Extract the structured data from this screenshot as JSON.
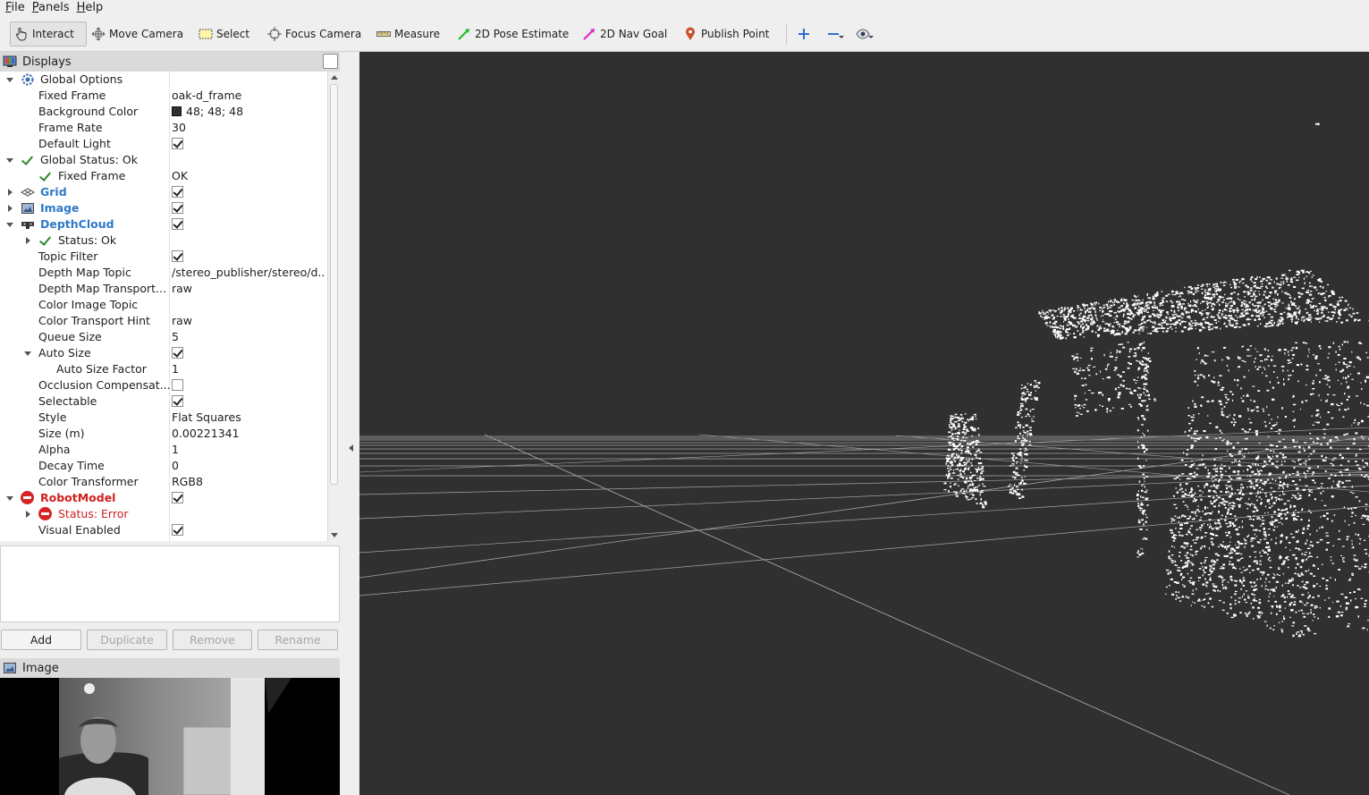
{
  "menu": [
    {
      "label": "File",
      "mnemonic": "F",
      "rest": "ile"
    },
    {
      "label": "Panels",
      "mnemonic": "P",
      "rest": "anels"
    },
    {
      "label": "Help",
      "mnemonic": "H",
      "rest": "elp"
    }
  ],
  "toolbar": {
    "interact": "Interact",
    "move_camera": "Move Camera",
    "select": "Select",
    "focus_camera": "Focus Camera",
    "measure": "Measure",
    "pose_estimate": "2D Pose Estimate",
    "nav_goal": "2D Nav Goal",
    "publish_point": "Publish Point"
  },
  "displays_panel": {
    "title": "Displays",
    "rows": [
      {
        "label": "Global Options",
        "value": ""
      },
      {
        "label": "Fixed Frame",
        "value": "oak-d_frame"
      },
      {
        "label": "Background Color",
        "value": "48; 48; 48"
      },
      {
        "label": "Frame Rate",
        "value": "30"
      },
      {
        "label": "Default Light",
        "checked": true
      },
      {
        "label": "Global Status: Ok",
        "value": ""
      },
      {
        "label": "Fixed Frame",
        "value": "OK"
      },
      {
        "label": "Grid",
        "checked": true
      },
      {
        "label": "Image",
        "checked": true
      },
      {
        "label": "DepthCloud",
        "checked": true
      },
      {
        "label": "Status: Ok",
        "value": ""
      },
      {
        "label": "Topic Filter",
        "checked": true
      },
      {
        "label": "Depth Map Topic",
        "value": "/stereo_publisher/stereo/d..."
      },
      {
        "label": "Depth Map Transport...",
        "value": "raw"
      },
      {
        "label": "Color Image Topic",
        "value": ""
      },
      {
        "label": "Color Transport Hint",
        "value": "raw"
      },
      {
        "label": "Queue Size",
        "value": "5"
      },
      {
        "label": "Auto Size",
        "checked": true
      },
      {
        "label": "Auto Size Factor",
        "value": "1"
      },
      {
        "label": "Occlusion Compensat...",
        "checked": false
      },
      {
        "label": "Selectable",
        "checked": true
      },
      {
        "label": "Style",
        "value": "Flat Squares"
      },
      {
        "label": "Size (m)",
        "value": "0.00221341"
      },
      {
        "label": "Alpha",
        "value": "1"
      },
      {
        "label": "Decay Time",
        "value": "0"
      },
      {
        "label": "Color Transformer",
        "value": "RGB8"
      },
      {
        "label": "RobotModel",
        "checked": true
      },
      {
        "label": "Status: Error",
        "value": ""
      },
      {
        "label": "Visual Enabled",
        "checked": true
      }
    ]
  },
  "buttons": {
    "add": "Add",
    "duplicate": "Duplicate",
    "remove": "Remove",
    "rename": "Rename"
  },
  "image_panel": {
    "title": "Image"
  },
  "colors": {
    "viewport_bg": "#303030",
    "status_ok": "#2a8a2a",
    "status_error": "#d02020",
    "display_name": "#2d79c7"
  }
}
